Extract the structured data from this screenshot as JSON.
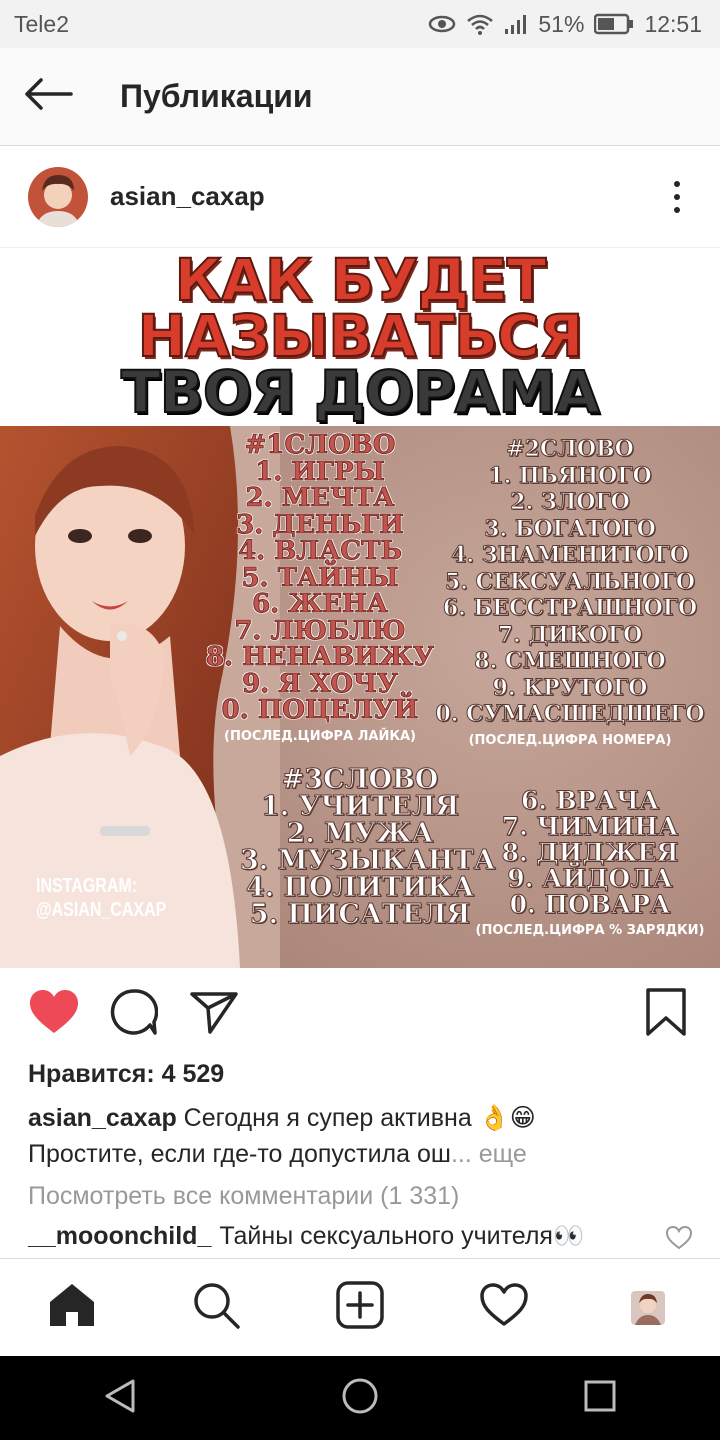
{
  "status_bar": {
    "carrier": "Tele2",
    "battery": "51%",
    "time": "12:51"
  },
  "header": {
    "title": "Публикации"
  },
  "post": {
    "username": "asian_caxap",
    "image": {
      "headline": [
        "КАК БУДЕТ",
        "НАЗЫВАТЬСЯ",
        "ТВОЯ ДОРАМА"
      ],
      "list1": [
        "#1СЛОВО",
        "1. ИГРЫ",
        "2. МЕЧТА",
        "3. ДЕНЬГИ",
        "4. ВЛАСТЬ",
        "5. ТАЙНЫ",
        "6. ЖЕНА",
        "7. ЛЮБЛЮ",
        "8. НЕНАВИЖУ",
        "9. Я ХОЧУ",
        "0. ПОЦЕЛУЙ"
      ],
      "list1_note": "(ПОСЛЕД.ЦИФРА ЛАЙКА)",
      "list2": [
        "#2СЛОВО",
        "1. ПЬЯНОГО",
        "2. ЗЛОГО",
        "3. БОГАТОГО",
        "4. ЗНАМЕНИТОГО",
        "5. СЕКСУАЛЬНОГО",
        "6. БЕССТРАШНОГО",
        "7. ДИКОГО",
        "8. СМЕШНОГО",
        "9. КРУТОГО",
        "0. СУМАСШЕДШЕГО"
      ],
      "list2_note": "(ПОСЛЕД.ЦИФРА НОМЕРА)",
      "list3": [
        "#3СЛОВО",
        "1. УЧИТЕЛЯ",
        "2. МУЖА",
        "3. МУЗЫКАНТА",
        "4. ПОЛИТИКА",
        "5. ПИСАТЕЛЯ"
      ],
      "list4": [
        "6. ВРАЧА",
        "7. ЧИМИНА",
        "8. ДИДЖЕЯ",
        "9. АЙДОЛА",
        "0. ПОВАРА"
      ],
      "list4_note": "(ПОСЛЕД.ЦИФРА % ЗАРЯДКИ)",
      "watermark": [
        "INSTAGRAM:",
        "@ASIAN_CAXAP"
      ]
    },
    "likes": "Нравится: 4 529",
    "caption_user": "asian_caxap",
    "caption_text": "Сегодня я супер активна 👌😁",
    "caption_line2": "Простите, если где-то допустила ош",
    "caption_more": "... еще",
    "view_all": "Посмотреть все комментарии (1 331)",
    "comment_user": "__mooonchild_",
    "comment_text": "Тайны сексуального учителя👀"
  },
  "colors": {
    "like_red": "#ed4956",
    "icon": "#262626",
    "muted": "#999999"
  },
  "icons": {
    "back": "arrow-left-icon",
    "more": "more-vertical-icon",
    "like": "heart-filled-icon",
    "comment": "comment-icon",
    "share": "send-icon",
    "save": "bookmark-icon",
    "home": "home-icon",
    "search": "search-icon",
    "add": "add-post-icon",
    "activity": "heart-outline-icon",
    "profile": "profile-avatar"
  }
}
